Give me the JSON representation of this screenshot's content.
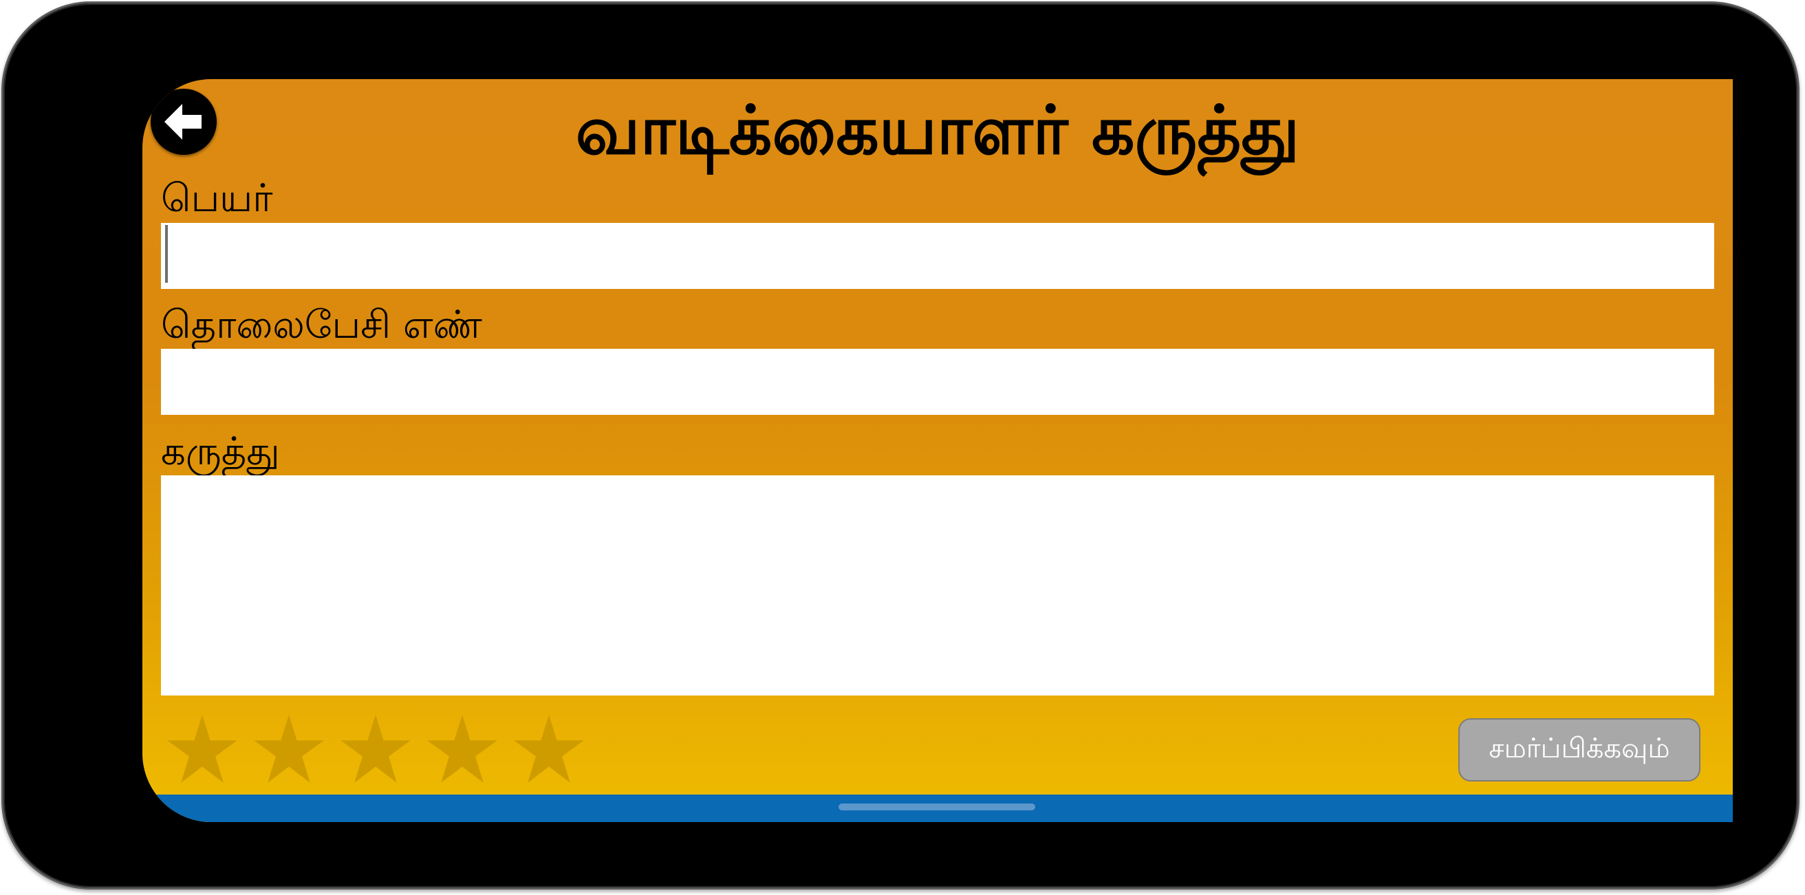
{
  "header": {
    "title": "வாடிக்கையாளர் கருத்து",
    "back_icon": "arrow-left-icon"
  },
  "form": {
    "name_label": "பெயர்",
    "name_value": "",
    "phone_label": "தொலைபேசி எண்",
    "phone_value": "",
    "comment_label": "கருத்து",
    "comment_value": ""
  },
  "rating": {
    "stars": 5,
    "selected": 0,
    "star_icon": "star-icon",
    "star_color": "#cf9c00"
  },
  "actions": {
    "submit_label": "சமர்ப்பிக்கவும்"
  },
  "colors": {
    "background_top": "#dc8a14",
    "background_bottom": "#efbc00",
    "nav_bar": "#0a6ab4",
    "submit_disabled": "#a8a8a8"
  }
}
